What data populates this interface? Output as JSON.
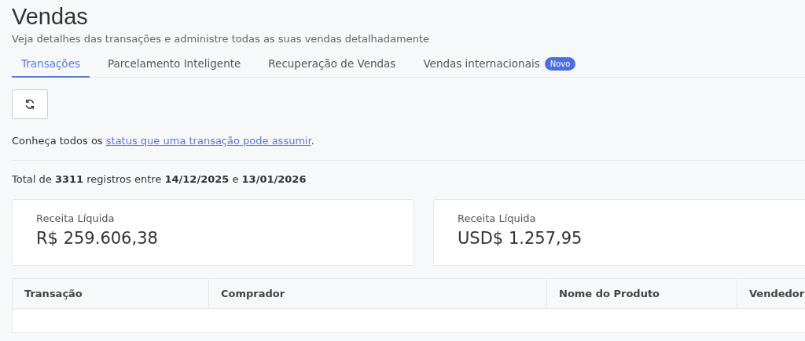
{
  "page": {
    "title": "Vendas",
    "subtitle": "Veja detalhes das transações e administre todas as suas vendas detalhadamente"
  },
  "tabs": [
    {
      "label": "Transações",
      "selected": true
    },
    {
      "label": "Parcelamento Inteligente",
      "selected": false
    },
    {
      "label": "Recuperação de Vendas",
      "selected": false
    },
    {
      "label": "Vendas internacionais",
      "selected": false,
      "badge": "Novo"
    }
  ],
  "info": {
    "before": "Conheça todos os ",
    "link": "status que uma transação pode assumir",
    "after": "."
  },
  "summary": "Total de **3311** registros entre **14/12/2025** e **13/01/2026**",
  "cards": [
    {
      "label": "Receita Líquida",
      "value": "R$ 259.606,38"
    },
    {
      "label": "Receita Líquida",
      "value": "USD$ 1.257,95"
    }
  ],
  "table": {
    "columns": [
      "Transação",
      "Comprador",
      "Nome do Produto",
      "Vendedor"
    ]
  }
}
